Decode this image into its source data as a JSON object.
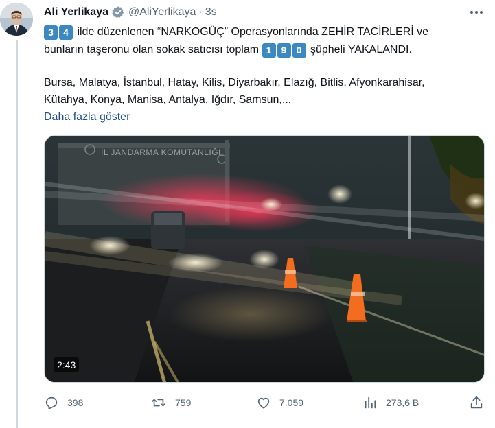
{
  "author": {
    "name": "Ali Yerlikaya",
    "handle": "@AliYerlikaya",
    "separator": "·",
    "time": "3s"
  },
  "tweet": {
    "line1_keys": [
      "3",
      "4"
    ],
    "line1_text": " ilde düzenlenen “NARKOGÜÇ” Operasyonlarında ZEHİR TACİRLERİ ve",
    "line2_text_before": "bunların taşeronu olan sokak satıcısı toplam ",
    "line2_keys": [
      "1",
      "9",
      "0"
    ],
    "line2_text_after": " şüpheli YAKALANDI.",
    "line3_text": "Bursa, Malatya, İstanbul, Hatay, Kilis, Diyarbakır, Elazığ, Bitlis, Afyonkarahisar,",
    "line4_text": "Kütahya, Konya, Manisa, Antalya, Iğdır, Samsun,...",
    "show_more": "Daha fazla göster"
  },
  "media": {
    "building_sign": "İL JANDARMA KOMUTANLIĞI",
    "duration": "2:43"
  },
  "actions": {
    "reply_count": "398",
    "retweet_count": "759",
    "like_count": "7.059",
    "views_count": "273,6 B"
  },
  "colors": {
    "accent": "#1d9bf0",
    "link": "#1d4e89",
    "muted": "#536471",
    "keycap": "#3b88c3"
  },
  "icons": [
    "verified-badge-icon",
    "more-icon",
    "reply-icon",
    "retweet-icon",
    "like-icon",
    "views-icon",
    "share-icon"
  ]
}
